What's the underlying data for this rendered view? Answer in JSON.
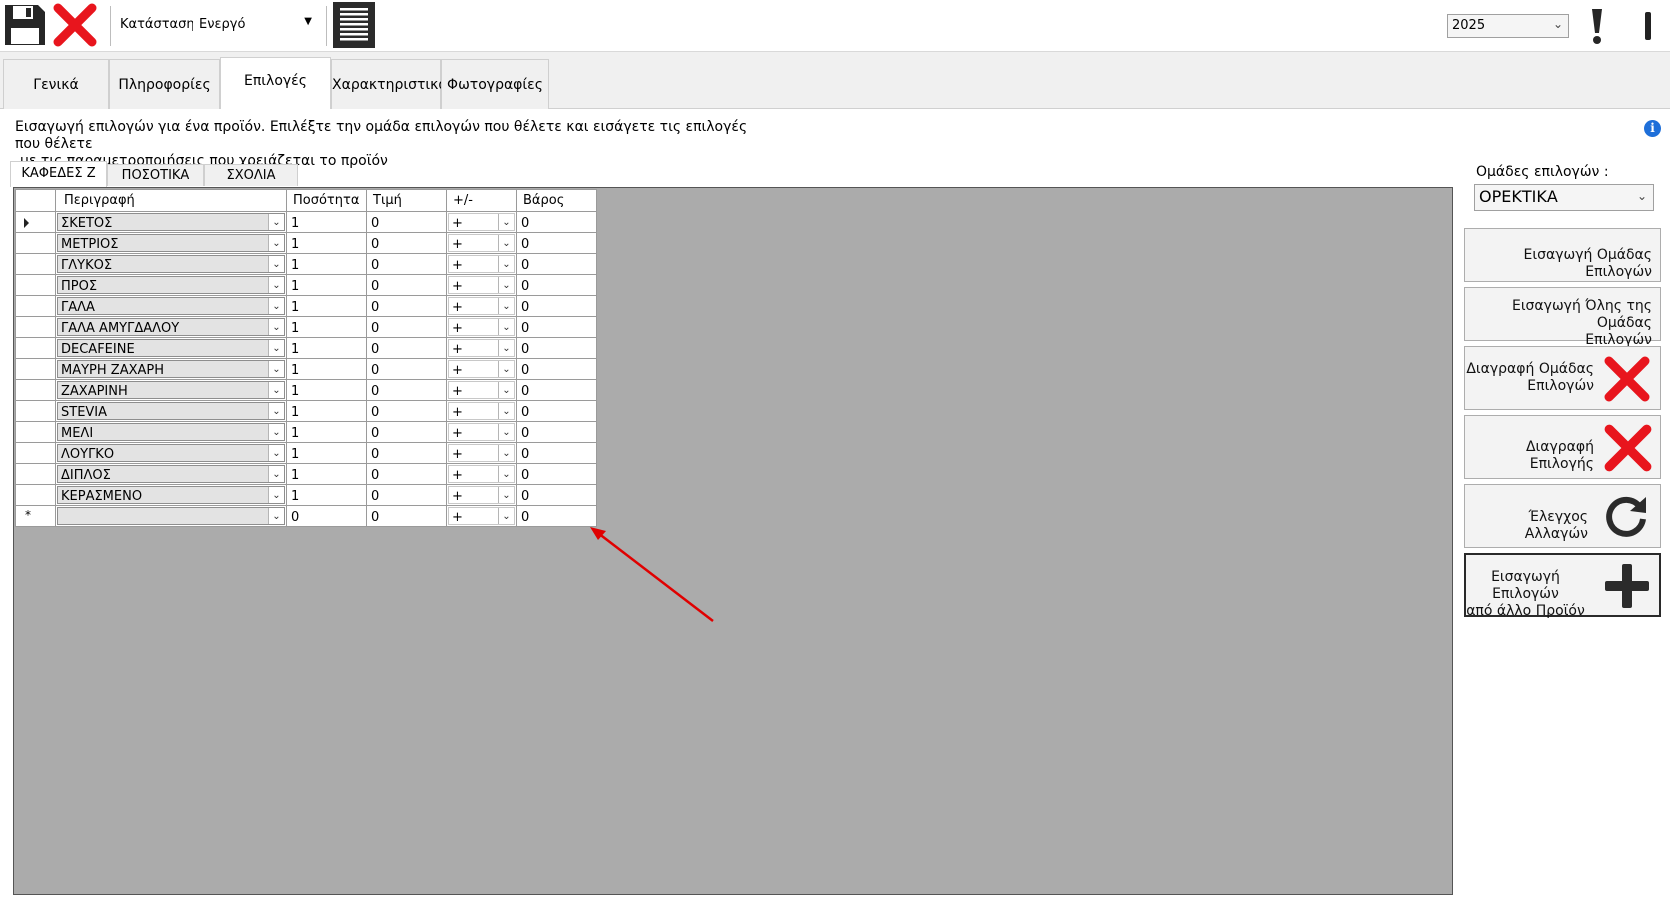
{
  "toolbar": {
    "status_label": "Κατάσταση :",
    "status_value": "Ενεργό",
    "year_value": "2025",
    "icons": [
      "save-icon",
      "close-icon",
      "list-icon",
      "exclamation-icon"
    ]
  },
  "main_tabs": [
    "Γενικά",
    "Πληροφορίες",
    "Επιλογές",
    "Χαρακτηριστικά",
    "Φωτογραφίες"
  ],
  "active_main_tab": "Επιλογές",
  "description": {
    "line1": "Εισαγωγή επιλογών για ένα προϊόν. Επιλέξτε την ομάδα επιλογών που θέλετε και εισάγετε τις επιλογές που θέλετε",
    "line2": "με τις παραμετροποιήσεις που χρειάζεται το προϊόν"
  },
  "sub_tabs": [
    "ΚΑΦΕΔΕΣ Ζ",
    "ΠΟΣΟΤΙΚΑ",
    "ΣΧΟΛΙΑ"
  ],
  "active_sub_tab": "ΚΑΦΕΔΕΣ Ζ",
  "grid": {
    "columns": [
      "Περιγραφή",
      "Ποσότητα",
      "Τιμή",
      "+/-",
      "Βάρος"
    ],
    "rows": [
      {
        "desc": "ΣΚΕΤΟΣ",
        "qty": "1",
        "price": "0",
        "sign": "+",
        "weight": "0"
      },
      {
        "desc": "ΜΕΤΡΙΟΣ",
        "qty": "1",
        "price": "0",
        "sign": "+",
        "weight": "0"
      },
      {
        "desc": "ΓΛΥΚΟΣ",
        "qty": "1",
        "price": "0",
        "sign": "+",
        "weight": "0"
      },
      {
        "desc": "ΠΡΟΣ",
        "qty": "1",
        "price": "0",
        "sign": "+",
        "weight": "0"
      },
      {
        "desc": "ΓΑΛΑ",
        "qty": "1",
        "price": "0",
        "sign": "+",
        "weight": "0"
      },
      {
        "desc": "ΓΑΛΑ ΑΜΥΓΔΑΛΟΥ",
        "qty": "1",
        "price": "0",
        "sign": "+",
        "weight": "0"
      },
      {
        "desc": "DECAFEINE",
        "qty": "1",
        "price": "0",
        "sign": "+",
        "weight": "0"
      },
      {
        "desc": "ΜΑΥΡΗ ΖΑΧΑΡΗ",
        "qty": "1",
        "price": "0",
        "sign": "+",
        "weight": "0"
      },
      {
        "desc": "ΖΑΧΑΡΙΝΗ",
        "qty": "1",
        "price": "0",
        "sign": "+",
        "weight": "0"
      },
      {
        "desc": "STEVIA",
        "qty": "1",
        "price": "0",
        "sign": "+",
        "weight": "0"
      },
      {
        "desc": "ΜΕΛΙ",
        "qty": "1",
        "price": "0",
        "sign": "+",
        "weight": "0"
      },
      {
        "desc": "ΛΟΥΓΚΟ",
        "qty": "1",
        "price": "0",
        "sign": "+",
        "weight": "0"
      },
      {
        "desc": "ΔΙΠΛΟΣ",
        "qty": "1",
        "price": "0",
        "sign": "+",
        "weight": "0"
      },
      {
        "desc": "ΚΕΡΑΣΜΕΝΟ",
        "qty": "1",
        "price": "0",
        "sign": "+",
        "weight": "0"
      }
    ],
    "new_row": {
      "desc": "",
      "qty": "0",
      "price": "0",
      "sign": "+",
      "weight": "0"
    },
    "new_row_marker": "*"
  },
  "right_panel": {
    "groups_label": "Ομάδες επιλογών :",
    "groups_value": "ΟΡΕΚΤΙΚΑ",
    "buttons": {
      "add_group": "Εισαγωγή Ομάδας Επιλογών",
      "add_whole_group_1": "Εισαγωγή Όλης της Ομάδας",
      "add_whole_group_2": "Επιλογών",
      "delete_group_1": "Διαγραφή Ομάδας",
      "delete_group_2": "Επιλογών",
      "delete_option": "Διαγραφή Επιλογής",
      "check_changes": "Έλεγχος Αλλαγών",
      "import_other_1": "Εισαγωγή Επιλογών",
      "import_other_2": "από άλλο Προϊόν"
    }
  },
  "colors": {
    "delete_red": "#e8151d",
    "annotation_red": "#e00000",
    "info_blue": "#1e6fd9"
  }
}
